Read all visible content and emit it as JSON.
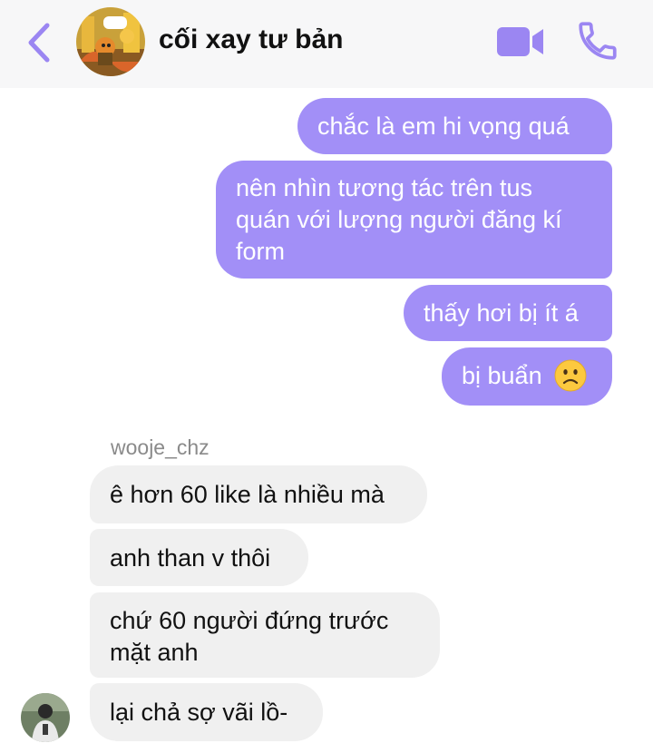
{
  "header": {
    "title": "cối xay tư bản",
    "back_icon": "chevron-left-icon",
    "video_icon": "video-camera-icon",
    "phone_icon": "phone-icon",
    "accent_color": "#9b86f2"
  },
  "messages_out": [
    {
      "text": "chắc là em hi vọng quá"
    },
    {
      "lines": [
        "nên nhìn tương tác trên tus",
        "quán với lượng người đăng kí",
        "form"
      ]
    },
    {
      "text": "thấy hơi bị ít á"
    },
    {
      "text": "bị buẩn",
      "emoji": "slightly-frowning-face"
    }
  ],
  "sender": {
    "name": "wooje_chz"
  },
  "messages_in": [
    {
      "text": "ê hơn 60 like là nhiều mà"
    },
    {
      "text": "anh than v thôi"
    },
    {
      "lines": [
        "chứ 60 người đứng trước",
        "mặt anh"
      ]
    },
    {
      "text": "lại chả sợ vãi lồ-"
    }
  ],
  "colors": {
    "outgoing_bubble": "#a28ff7",
    "incoming_bubble": "#f0f0f0",
    "header_bg": "#f7f7f8"
  }
}
